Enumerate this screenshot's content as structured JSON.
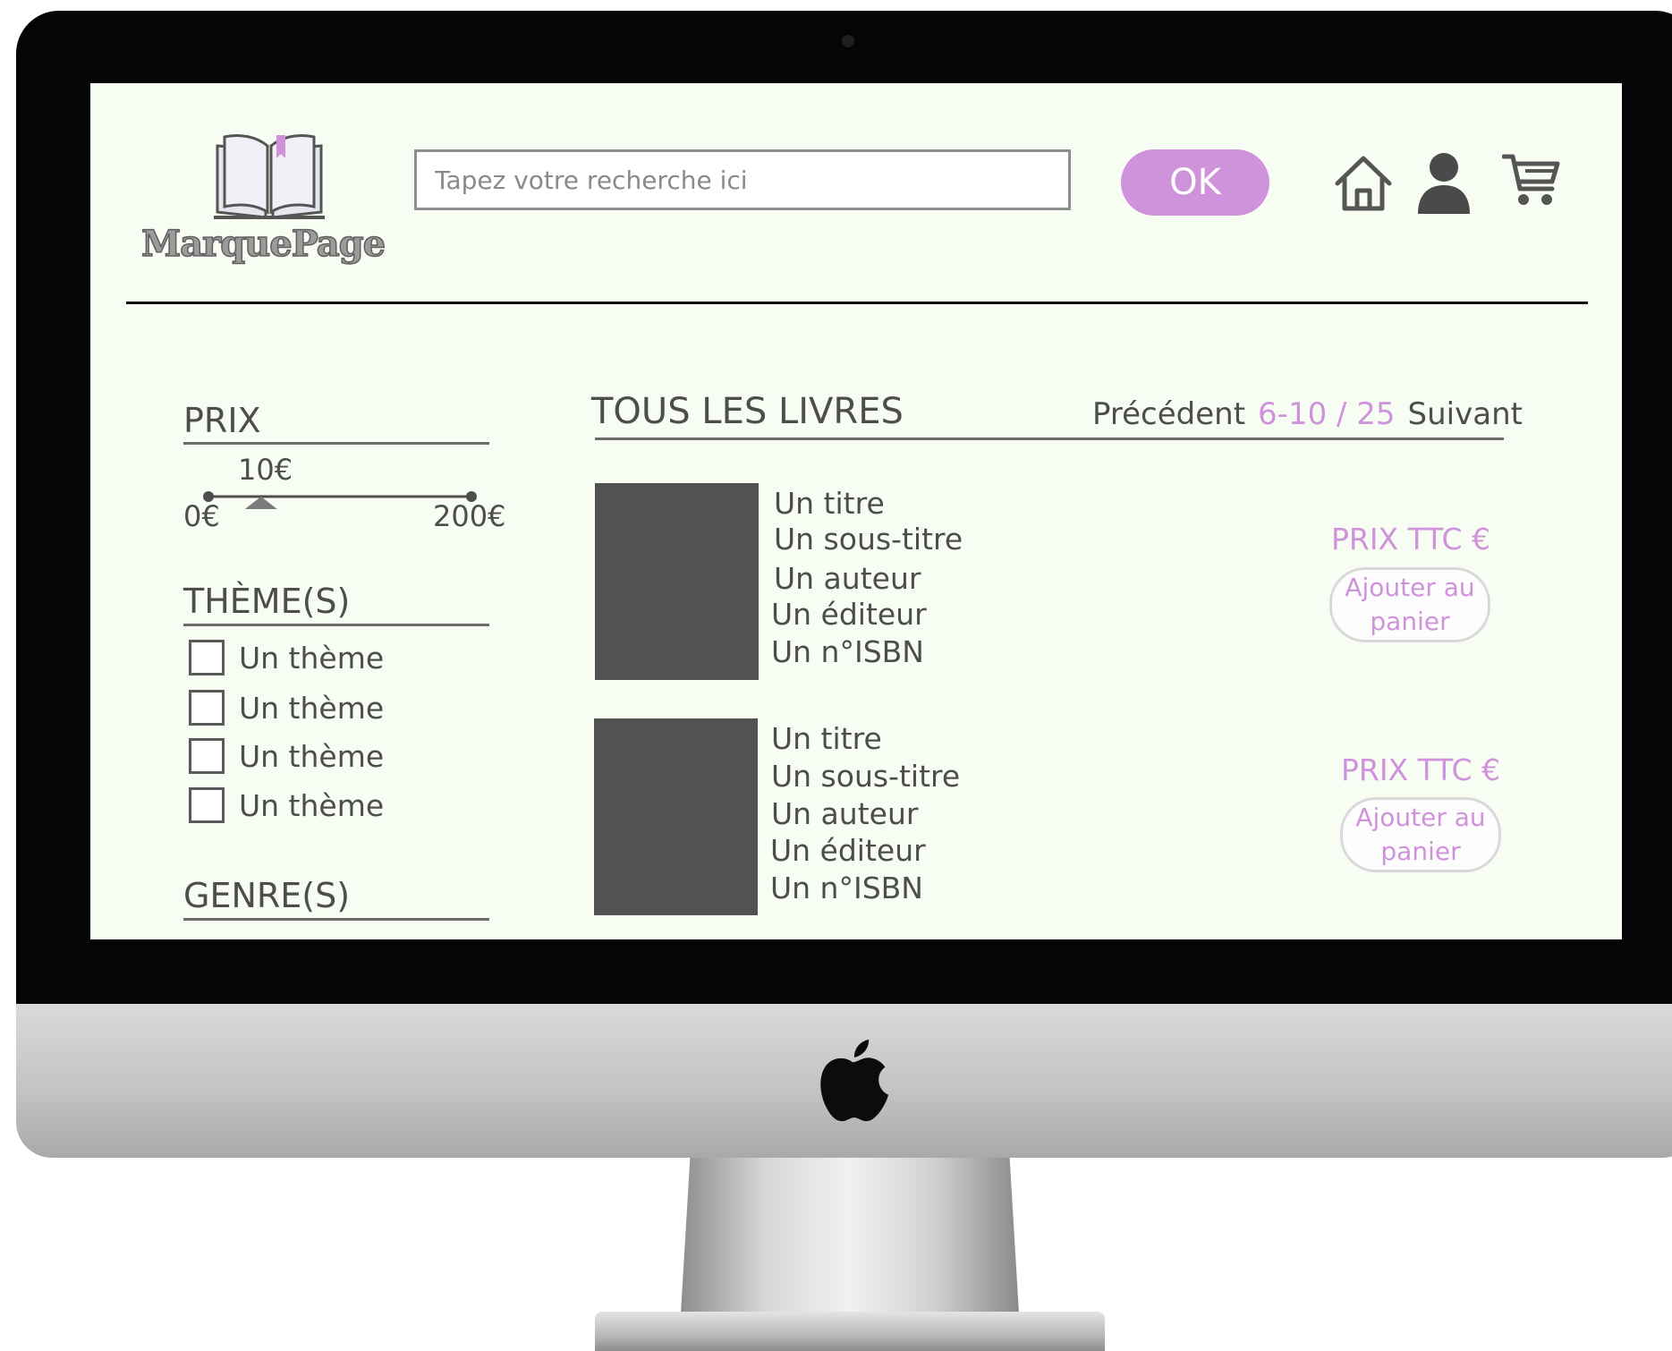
{
  "header": {
    "logo_text": "MarquePage",
    "search": {
      "placeholder": "Tapez votre recherche ici",
      "value": ""
    },
    "ok_label": "OK",
    "icons": [
      "home-icon",
      "user-icon",
      "cart-icon"
    ]
  },
  "filters": {
    "price": {
      "title": "PRIX",
      "current": "10€",
      "min": "0€",
      "max": "200€",
      "value_fraction": 0.2
    },
    "themes": {
      "title": "THÈME(S)",
      "items": [
        {
          "label": "Un thème",
          "checked": false
        },
        {
          "label": "Un thème",
          "checked": false
        },
        {
          "label": "Un thème",
          "checked": false
        },
        {
          "label": "Un thème",
          "checked": false
        }
      ]
    },
    "genres": {
      "title": "GENRE(S)"
    }
  },
  "list": {
    "title": "TOUS LES LIVRES",
    "pagination": {
      "prev": "Précédent",
      "range": "6-10 / 25",
      "next": "Suivant"
    },
    "books": [
      {
        "title": "Un titre",
        "subtitle": "Un sous-titre",
        "author": "Un auteur",
        "publisher": "Un éditeur",
        "isbn": "Un n°ISBN",
        "price": "PRIX TTC €",
        "add_label": "Ajouter au panier"
      },
      {
        "title": "Un titre",
        "subtitle": "Un sous-titre",
        "author": "Un auteur",
        "publisher": "Un éditeur",
        "isbn": "Un n°ISBN",
        "price": "PRIX TTC €",
        "add_label": "Ajouter au panier"
      }
    ]
  },
  "colors": {
    "accent": "#cf93dc",
    "screen_bg": "#f8fdf3",
    "text": "#4d4d4d",
    "cover": "#525252"
  }
}
